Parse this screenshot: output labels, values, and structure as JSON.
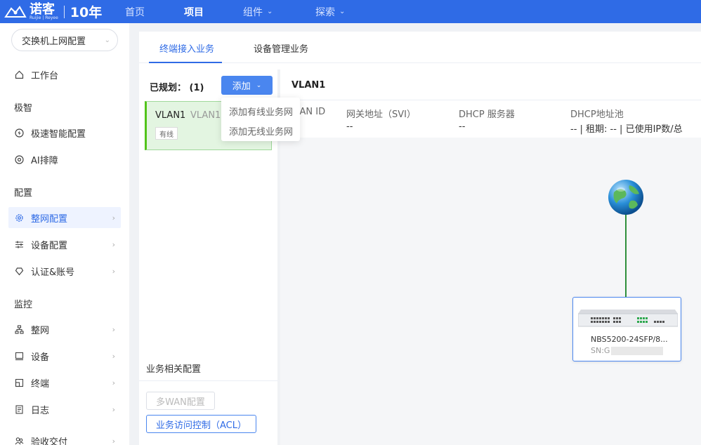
{
  "topbar": {
    "logo_text": "诺客",
    "logo_subtext": "Ruijie | Reyee",
    "logo_ten": "10年",
    "nav": [
      {
        "label": "首页",
        "has_caret": false
      },
      {
        "label": "项目",
        "has_caret": false
      },
      {
        "label": "组件",
        "has_caret": true
      },
      {
        "label": "探索",
        "has_caret": true
      }
    ]
  },
  "sidebar": {
    "project_selector": "交换机上网配置",
    "workbench": "工作台",
    "groups": [
      {
        "title": "极智"
      },
      {
        "title": "配置"
      },
      {
        "title": "监控"
      }
    ],
    "items": [
      {
        "label": "极速智能配置",
        "icon": "bolt-icon"
      },
      {
        "label": "AI排障",
        "icon": "ai-icon"
      },
      {
        "label": "整网配置",
        "icon": "gear-icon"
      },
      {
        "label": "设备配置",
        "icon": "sliders-icon"
      },
      {
        "label": "认证&账号",
        "icon": "shield-icon"
      },
      {
        "label": "整网",
        "icon": "topology-icon"
      },
      {
        "label": "设备",
        "icon": "device-icon"
      },
      {
        "label": "终端",
        "icon": "terminal-icon"
      },
      {
        "label": "日志",
        "icon": "log-icon"
      },
      {
        "label": "验收交付",
        "icon": "users-icon"
      }
    ]
  },
  "tabs": [
    "终端接入业务",
    "设备管理业务"
  ],
  "left_panel": {
    "planned_label": "已规划：",
    "planned_count": "(1)",
    "add_button": "添加",
    "vlan_card": {
      "name": "VLAN1",
      "sub": "VLAN1",
      "tag": "有线"
    },
    "dropdown": [
      "添加有线业务网",
      "添加无线业务网"
    ],
    "related_title": "业务相关配置",
    "buttons": {
      "multi_wan": "多WAN配置",
      "acl": "业务访问控制（ACL）"
    }
  },
  "right_panel": {
    "title": "VLAN1",
    "columns": [
      {
        "label": "LAN ID",
        "value": ""
      },
      {
        "label": "网关地址（SVI）",
        "value": "--"
      },
      {
        "label": "DHCP 服务器",
        "value": "--"
      },
      {
        "label": "DHCP地址池",
        "value": "--  |  租期: --  |  已使用IP数/总"
      }
    ],
    "device": {
      "name": "NBS5200-24SFP/8...",
      "sn_prefix": "SN:G"
    }
  },
  "colors": {
    "primary": "#2f6be6",
    "success": "#52c41a",
    "card_bg": "#e3f5e1"
  }
}
